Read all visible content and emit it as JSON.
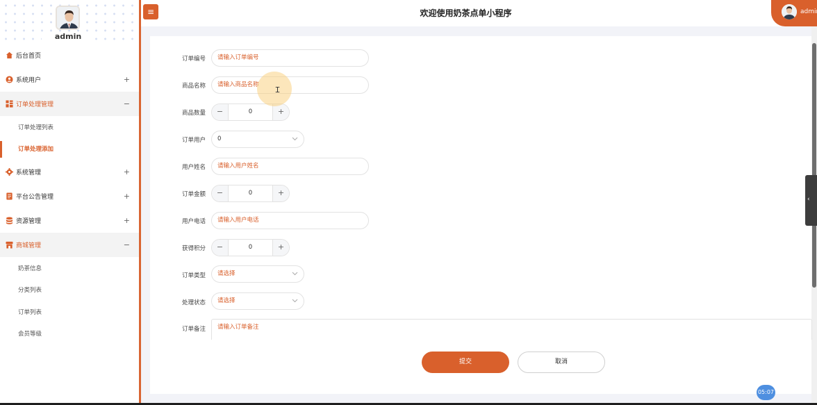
{
  "sidebar": {
    "username": "admin",
    "menu": [
      {
        "label": "后台首页",
        "icon": "home-icon",
        "toggle": ""
      },
      {
        "label": "系统用户",
        "icon": "user-icon",
        "toggle": "+"
      },
      {
        "label": "订单处理管理",
        "icon": "grid-icon",
        "toggle": "−",
        "submenu": [
          "订单处理列表",
          "订单处理添加"
        ]
      },
      {
        "label": "系统管理",
        "icon": "gear-icon",
        "toggle": "+"
      },
      {
        "label": "平台公告管理",
        "icon": "document-icon",
        "toggle": "+"
      },
      {
        "label": "资源管理",
        "icon": "database-icon",
        "toggle": "+"
      },
      {
        "label": "商城管理",
        "icon": "store-icon",
        "toggle": "−",
        "submenu": [
          "奶茶信息",
          "分类列表",
          "订单列表",
          "会员等级"
        ]
      }
    ]
  },
  "header": {
    "menu_toggle_glyph": "≡",
    "title": "欢迎使用奶茶点单小程序",
    "user_name": "admin"
  },
  "form": {
    "order_no": {
      "label": "订单编号",
      "placeholder": "请输入订单编号"
    },
    "product_name": {
      "label": "商品名称",
      "placeholder": "请输入商品名称"
    },
    "quantity": {
      "label": "商品数量",
      "value": "0"
    },
    "order_user": {
      "label": "订单用户",
      "value": "0"
    },
    "user_name": {
      "label": "用户姓名",
      "placeholder": "请输入用户姓名"
    },
    "amount": {
      "label": "订单金额",
      "value": "0"
    },
    "phone": {
      "label": "用户电话",
      "placeholder": "请输入用户电话"
    },
    "points": {
      "label": "获得积分",
      "value": "0"
    },
    "order_type": {
      "label": "订单类型",
      "placeholder": "请选择"
    },
    "status": {
      "label": "处理状态",
      "placeholder": "请选择"
    },
    "remark": {
      "label": "订单备注",
      "placeholder": "请输入订单备注"
    }
  },
  "stepper": {
    "minus": "−",
    "plus": "+"
  },
  "buttons": {
    "submit": "提交",
    "cancel": "取消"
  },
  "timer": "05:07",
  "colors": {
    "accent": "#d9602c",
    "background": "#f2f3f8",
    "timer": "#4e8fe0"
  }
}
